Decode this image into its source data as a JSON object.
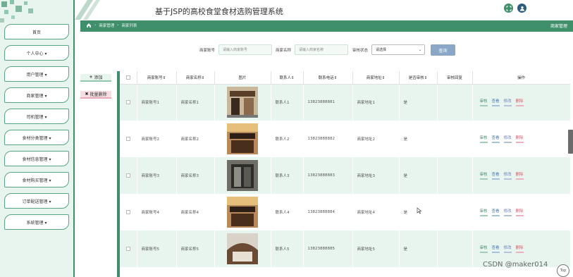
{
  "header": {
    "app_title": "基于JSP的高校食堂食材选购管理系统",
    "fullscreen_icon": "expand-icon",
    "user_icon": "user-icon",
    "accent": "#3f8f6a"
  },
  "breadcrumb": {
    "home_icon": "home-icon",
    "items": [
      "商家管理",
      "商家列表"
    ],
    "right_label": "商家管理"
  },
  "sidebar": {
    "items": [
      {
        "label": "首页"
      },
      {
        "label": "个人中心 ▾"
      },
      {
        "label": "用户管理 ▾"
      },
      {
        "label": "商家管理 ▾"
      },
      {
        "label": "司机管理 ▾"
      },
      {
        "label": "食材分类管理 ▾"
      },
      {
        "label": "食材信息管理 ▾"
      },
      {
        "label": "食材购买管理 ▾"
      },
      {
        "label": "订单配送管理 ▾"
      },
      {
        "label": "系统管理 ▾"
      }
    ]
  },
  "search": {
    "account_label": "商家账号",
    "account_placeholder": "请输入商家账号",
    "name_label": "商家名称",
    "name_placeholder": "请输入商家名称",
    "status_label": "审核状态",
    "status_selected": "请选择",
    "query_label": "查询"
  },
  "actions": {
    "add_label": "添加",
    "batch_delete_label": "批量删除"
  },
  "table": {
    "columns": [
      "商家账号⇕",
      "商家名称⇕",
      "图片",
      "联系人⇕",
      "联系电话⇕",
      "商家地址⇕",
      "是否审核⇕",
      "审核回复",
      "操作"
    ],
    "ops": [
      "审核",
      "查看",
      "修改",
      "删除"
    ],
    "rows": [
      {
        "account": "商家账号1",
        "name": "商家名称1",
        "contact": "联系人1",
        "phone": "13823888881",
        "address": "商家地址1",
        "audited": "是",
        "reply": ""
      },
      {
        "account": "商家账号2",
        "name": "商家名称2",
        "contact": "联系人2",
        "phone": "13823888882",
        "address": "商家地址2",
        "audited": "是",
        "reply": ""
      },
      {
        "account": "商家账号3",
        "name": "商家名称3",
        "contact": "联系人3",
        "phone": "13823888883",
        "address": "商家地址3",
        "audited": "是",
        "reply": ""
      },
      {
        "account": "商家账号4",
        "name": "商家名称4",
        "contact": "联系人4",
        "phone": "13823888884",
        "address": "商家地址4",
        "audited": "是",
        "reply": ""
      },
      {
        "account": "商家账号5",
        "name": "商家名称5",
        "contact": "联系人5",
        "phone": "13823888885",
        "address": "商家地址5",
        "audited": "是",
        "reply": ""
      }
    ]
  },
  "footer": {
    "watermark": "CSDN @maker014",
    "top_label": "Top"
  }
}
